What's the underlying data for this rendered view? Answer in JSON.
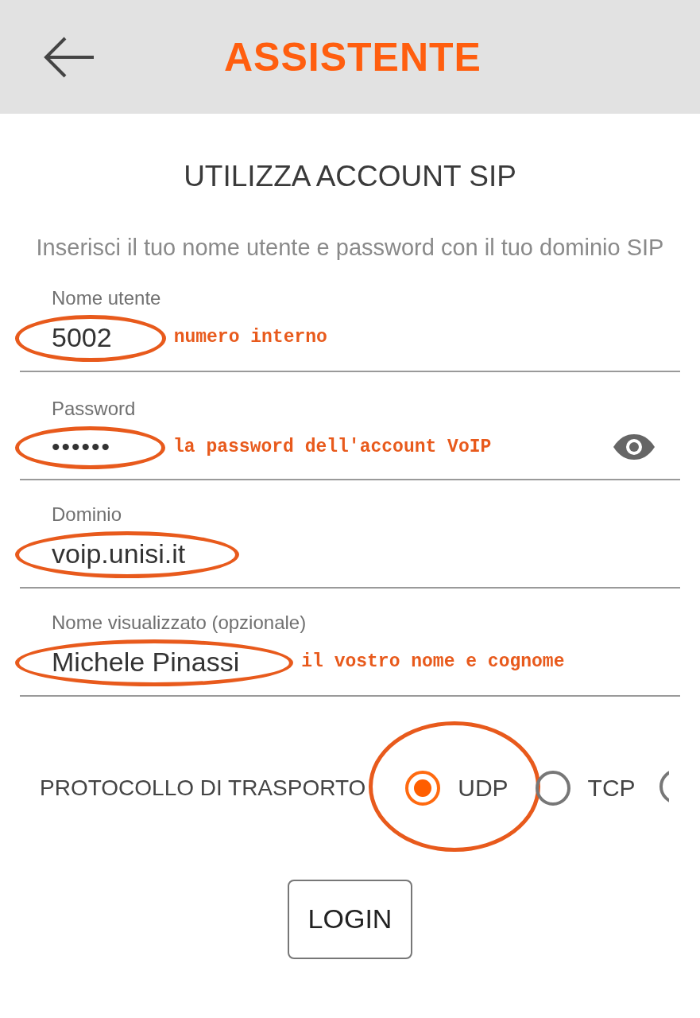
{
  "header": {
    "title": "ASSISTENTE"
  },
  "heading": "UTILIZZA ACCOUNT SIP",
  "description": "Inserisci il tuo nome utente e password con il tuo dominio SIP",
  "fields": [
    {
      "kind": "text",
      "label": "Nome utente",
      "value": "5002",
      "highlighted": true,
      "note": "numero interno"
    },
    {
      "kind": "password",
      "label": "Password",
      "value": "••••••",
      "highlighted": true,
      "note": "la password dell'account VoIP"
    },
    {
      "kind": "text",
      "label": "Dominio",
      "value": "voip.unisi.it",
      "highlighted": true
    },
    {
      "kind": "text",
      "label": "Nome visualizzato (opzionale)",
      "value": "Michele Pinassi",
      "highlighted": true,
      "note": "il vostro nome e cognome"
    }
  ],
  "transport": {
    "label": "PROTOCOLLO DI TRASPORTO",
    "options": [
      {
        "label": "UDP",
        "selected": true,
        "highlighted": true
      },
      {
        "label": "TCP",
        "selected": false,
        "highlighted": false
      },
      {
        "selected": false,
        "highlighted": false
      }
    ]
  },
  "login_button": "LOGIN"
}
